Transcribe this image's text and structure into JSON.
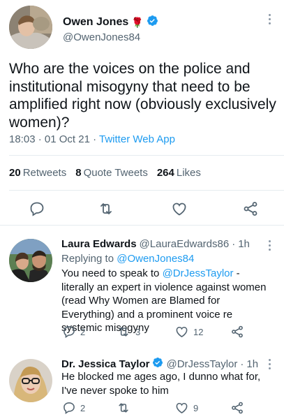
{
  "tweet": {
    "author_name": "Owen Jones",
    "author_emoji": "🌹",
    "author_handle": "@OwenJones84",
    "text": "Who are the voices on the police and institutional misogyny that need to be amplified right now (obviously exclusively women)?",
    "time": "18:03",
    "date": "01 Oct 21",
    "app": "Twitter Web App",
    "stats": {
      "retweets_count": "20",
      "retweets_label": "Retweets",
      "quotes_count": "8",
      "quotes_label": "Quote Tweets",
      "likes_count": "264",
      "likes_label": "Likes"
    }
  },
  "replies": [
    {
      "name": "Laura Edwards",
      "handle": "@LauraEdwards86",
      "time": "1h",
      "replying_label": "Replying to",
      "replying_to": "@OwenJones84",
      "text_before": "You need to speak to ",
      "mention": "@DrJessTaylor",
      "text_after": " - literally an expert in violence against women (read Why Women are Blamed for Everything) and a prominent voice re systemic misogyny",
      "reply_count": "2",
      "retweet_count": "3",
      "like_count": "12"
    },
    {
      "name": "Dr. Jessica Taylor",
      "handle": "@DrJessTaylor",
      "time": "1h",
      "text": "He blocked me ages ago, I dunno what for, I've never spoke to him",
      "reply_count": "2",
      "retweet_count": "",
      "like_count": "9"
    }
  ],
  "colors": {
    "accent": "#1d9bf0",
    "muted": "#536471",
    "text": "#0f1419",
    "verified": "#1d9bf0"
  },
  "icons": [
    "verified-badge-icon",
    "reply-icon",
    "retweet-icon",
    "like-icon",
    "share-icon",
    "more-icon"
  ]
}
